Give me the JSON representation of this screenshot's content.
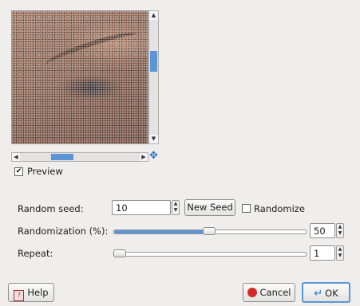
{
  "preview": {
    "checkbox_label": "Preview",
    "checked": true
  },
  "random_seed": {
    "label": "Random seed:",
    "value": "10",
    "new_seed_label": "New Seed",
    "randomize_label": "Randomize",
    "randomize_checked": false
  },
  "randomization": {
    "label": "Randomization (%):",
    "value": "50",
    "slider_fraction": 0.5
  },
  "repeat": {
    "label": "Repeat:",
    "value": "1",
    "slider_fraction": 0.0
  },
  "buttons": {
    "help": "Help",
    "cancel": "Cancel",
    "ok": "OK"
  },
  "icons": {
    "preview_checkmark": "checkmark-icon",
    "navigate": "navigate-icon",
    "help": "help-book-icon",
    "cancel": "cancel-icon",
    "ok": "ok-enter-icon"
  }
}
